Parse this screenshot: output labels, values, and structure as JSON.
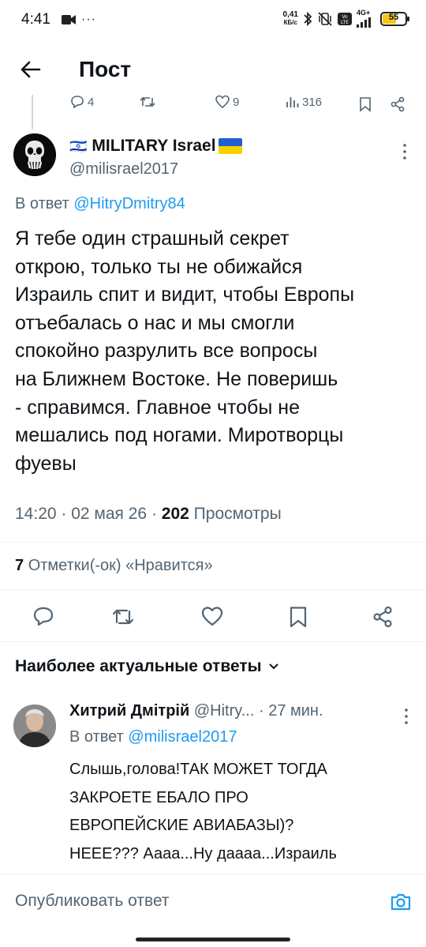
{
  "status_bar": {
    "time": "4:41",
    "dots": "···",
    "speed_value": "0,41",
    "speed_unit": "КБ/с",
    "network": "4G+",
    "battery": "55"
  },
  "header": {
    "title": "Пост"
  },
  "prev_actions": {
    "replies": "4",
    "likes": "9",
    "views": "316"
  },
  "tweet": {
    "author_name": "MILITARY Israel",
    "flag_left": "🇮🇱",
    "flag_right": "🇺🇦",
    "handle": "@milisrael2017",
    "reply_prefix": "В ответ",
    "reply_handle": "@HitryDmitry84",
    "text": "Я тебе один страшный секрет\nоткрою, только ты не обижайся\nИзраиль спит и видит, чтобы Европы\nотъебалась о нас и мы смогли\nспокойно разрулить все вопросы\nна Ближнем Востоке. Не поверишь\n- справимся. Главное чтобы не\nмешались под ногами. Миротворцы\nфуевы",
    "time": "14:20",
    "date": "02 мая 26",
    "views_count": "202",
    "views_label": "Просмотры",
    "likes_count": "7",
    "likes_label": "Отметки(-ок) «Нравится»"
  },
  "sort": {
    "label": "Наиболее актуальные ответы"
  },
  "reply": {
    "name": "Хитрий Дмітрій",
    "handle": "@Hitry...",
    "time": "27 мин.",
    "reply_prefix": "В ответ",
    "reply_handle": "@milisrael2017",
    "text": "Слышь,голова!ТАК МОЖЕТ ТОГДА\nЗАКРОЕТЕ ЕБАЛО ПРО\nЕВРОПЕЙСКИЕ АВИАБАЗЫ)?\nНЕЕЕ??? Аааа...Ну даааа...Израиль\nже рассчитывает только на себя...НО"
  },
  "composer": {
    "placeholder": "Опубликовать ответ"
  },
  "colors": {
    "accent": "#1d9bf0",
    "muted": "#536471",
    "text": "#0f1419",
    "battery": "#f5c518"
  }
}
